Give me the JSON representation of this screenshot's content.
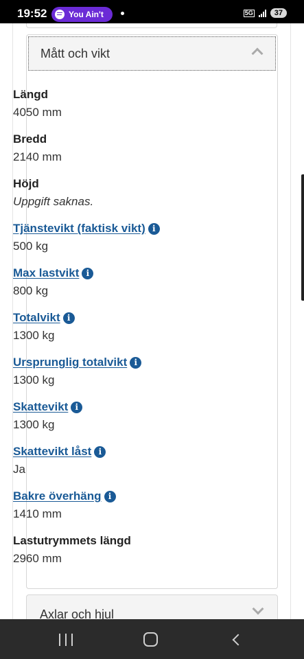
{
  "status_bar": {
    "time": "19:52",
    "media_text": "You Ain't",
    "network": "5G",
    "battery": "37"
  },
  "section": {
    "title": "Mått och vikt"
  },
  "fields": [
    {
      "label": "Längd",
      "value": "4050 mm"
    },
    {
      "label": "Bredd",
      "value": "2140 mm"
    },
    {
      "label": "Höjd",
      "value": "Uppgift saknas."
    },
    {
      "label": "Tjänstevikt (faktisk vikt)",
      "value": "500 kg"
    },
    {
      "label": "Max lastvikt",
      "value": "800 kg"
    },
    {
      "label": "Totalvikt",
      "value": "1300 kg"
    },
    {
      "label": "Ursprunglig totalvikt",
      "value": "1300 kg"
    },
    {
      "label": "Skattevikt",
      "value": "1300 kg"
    },
    {
      "label": "Skattevikt låst",
      "value": "Ja"
    },
    {
      "label": "Bakre överhäng",
      "value": "1410 mm"
    },
    {
      "label": "Lastutrymmets längd",
      "value": "2960 mm"
    }
  ],
  "next_section": {
    "title": "Axlar och hjul"
  },
  "info_icon_glyph": "i",
  "colors": {
    "link": "#1a5a96",
    "header_bg": "#f4f4f4",
    "media_pill": "#6b2bd6"
  }
}
